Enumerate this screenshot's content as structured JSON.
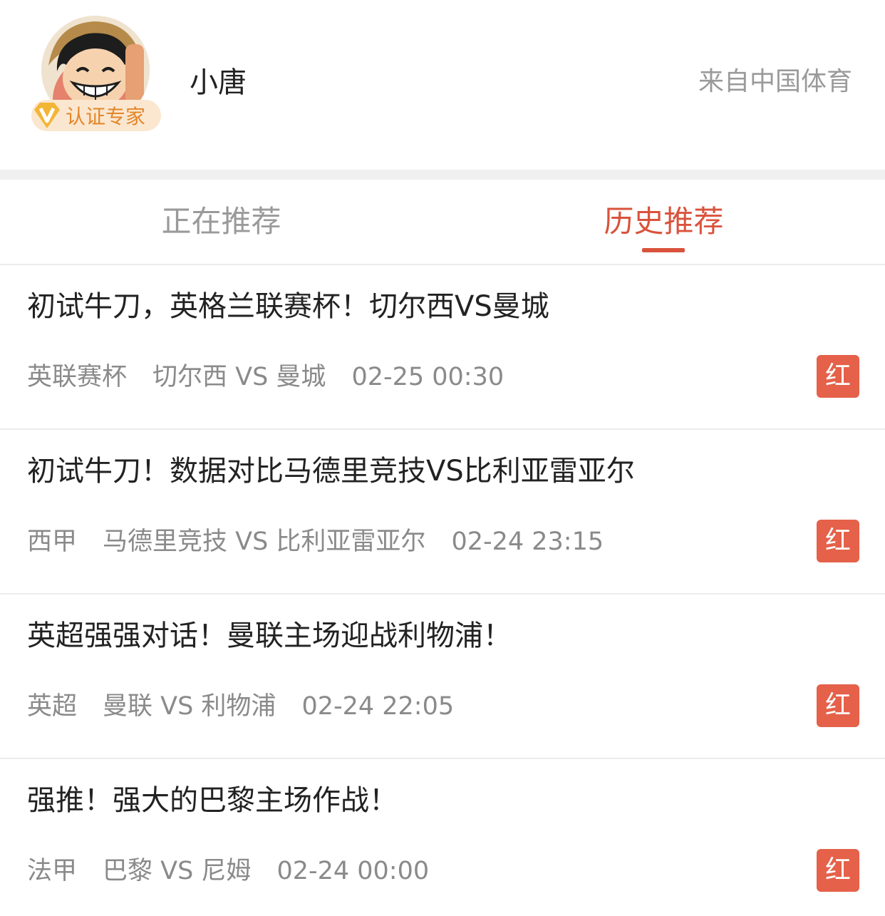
{
  "profile": {
    "name": "小唐",
    "badge": "认证专家",
    "source": "来自中国体育"
  },
  "tabs": [
    {
      "label": "正在推荐",
      "active": false
    },
    {
      "label": "历史推荐",
      "active": true
    }
  ],
  "items": [
    {
      "title": "初试牛刀，英格兰联赛杯！切尔西VS曼城",
      "league": "英联赛杯",
      "match": "切尔西 VS 曼城",
      "time": "02-25 00:30",
      "result": "红"
    },
    {
      "title": "初试牛刀！数据对比马德里竞技VS比利亚雷亚尔",
      "league": "西甲",
      "match": "马德里竞技 VS 比利亚雷亚尔",
      "time": "02-24 23:15",
      "result": "红"
    },
    {
      "title": "英超强强对话！曼联主场迎战利物浦！",
      "league": "英超",
      "match": "曼联 VS 利物浦",
      "time": "02-24 22:05",
      "result": "红"
    },
    {
      "title": "强推！强大的巴黎主场作战！",
      "league": "法甲",
      "match": "巴黎 VS 尼姆",
      "time": "02-24 00:00",
      "result": "红"
    }
  ],
  "colors": {
    "accent": "#d9533c",
    "result_badge": "#e5614a",
    "badge_bg": "#fbe7cf",
    "badge_text": "#e2862a"
  }
}
